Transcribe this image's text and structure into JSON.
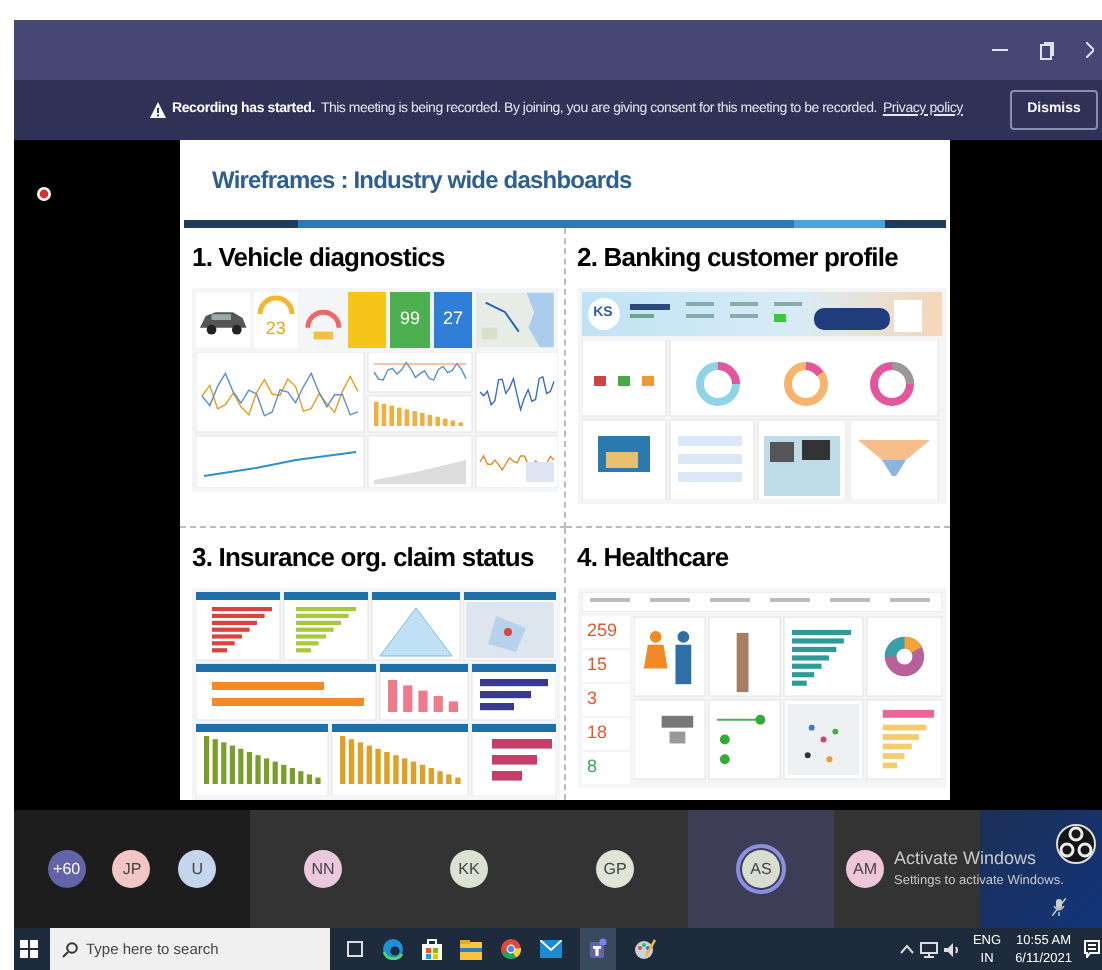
{
  "banner": {
    "title": "Recording has started.",
    "message": "This meeting is being recorded. By joining, you are giving consent for this meeting to be recorded.",
    "link": "Privacy policy",
    "button": "Dismiss"
  },
  "slide": {
    "title": "Wireframes : Industry wide dashboards",
    "panels": [
      {
        "heading": "1. Vehicle diagnostics",
        "kind": "vehicle",
        "metrics": [
          "23",
          "99",
          "27"
        ]
      },
      {
        "heading": "2. Banking customer profile",
        "kind": "banking",
        "badge": "KS"
      },
      {
        "heading": "3. Insurance org. claim status",
        "kind": "insurance"
      },
      {
        "heading": "4. Healthcare",
        "kind": "healthcare",
        "metrics": [
          "259",
          "15",
          "3",
          "18",
          "8"
        ]
      }
    ]
  },
  "participants": [
    {
      "initials": "+60",
      "color": "#6264a7",
      "speaking": false
    },
    {
      "initials": "JP",
      "color": "#f2c6c4",
      "speaking": false
    },
    {
      "initials": "U",
      "color": "#c6d5ee",
      "speaking": false
    },
    {
      "initials": "NN",
      "color": "#ecc8dc",
      "speaking": false
    },
    {
      "initials": "KK",
      "color": "#dbe1d3",
      "speaking": false
    },
    {
      "initials": "GP",
      "color": "#dfe4d4",
      "speaking": false
    },
    {
      "initials": "AS",
      "color": "#d9ddcf",
      "speaking": true
    },
    {
      "initials": "AM",
      "color": "#efc6d8",
      "speaking": false
    }
  ],
  "activation_notice": {
    "title": "Activate Windows",
    "message": "Settings to activate Windows."
  },
  "taskbar": {
    "search_placeholder": "Type here to search",
    "language": "ENG",
    "region": "IN",
    "time": "10:55 AM",
    "date": "6/11/2021"
  }
}
